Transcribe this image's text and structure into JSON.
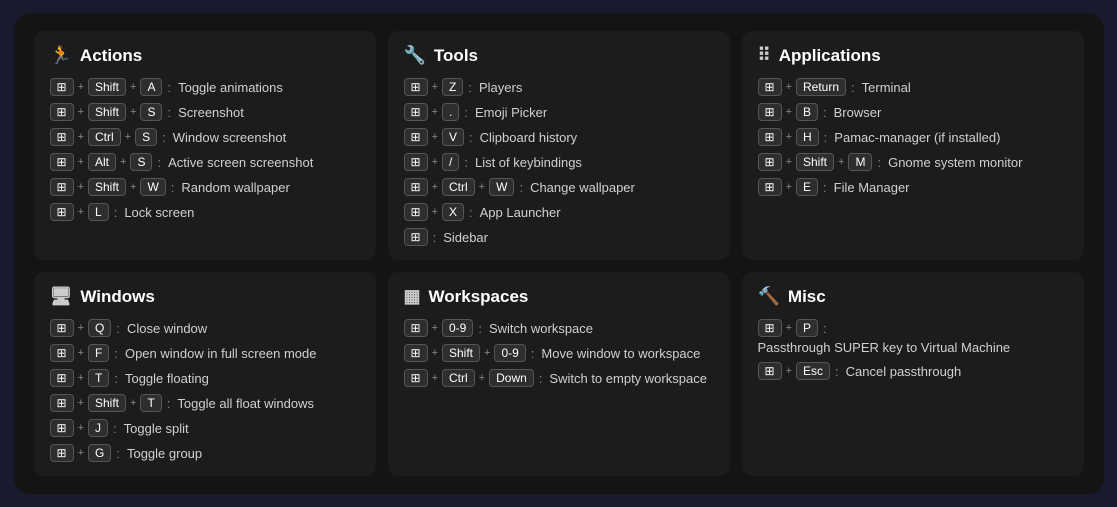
{
  "sections": [
    {
      "id": "actions",
      "icon": "♿",
      "title": "Actions",
      "rows": [
        {
          "keys": [
            [
              "Win"
            ],
            "+",
            [
              "Shift"
            ],
            "+",
            [
              "A"
            ]
          ],
          "label": "Toggle animations"
        },
        {
          "keys": [
            [
              "Win"
            ],
            "+",
            [
              "Shift"
            ],
            "+",
            [
              "S"
            ]
          ],
          "label": "Screenshot"
        },
        {
          "keys": [
            [
              "Win"
            ],
            "+",
            [
              "Ctrl"
            ],
            "+",
            [
              "S"
            ]
          ],
          "label": "Window screenshot"
        },
        {
          "keys": [
            [
              "Win"
            ],
            "+",
            [
              "Alt"
            ],
            "+",
            [
              "S"
            ]
          ],
          "label": "Active screen screenshot"
        },
        {
          "keys": [
            [
              "Win"
            ],
            "+",
            [
              "Shift"
            ],
            "+",
            [
              "W"
            ]
          ],
          "label": "Random wallpaper"
        },
        {
          "keys": [
            [
              "Win"
            ],
            "+",
            [
              "L"
            ]
          ],
          "label": "Lock screen"
        }
      ]
    },
    {
      "id": "tools",
      "icon": "🔧",
      "title": "Tools",
      "rows": [
        {
          "keys": [
            [
              "Win"
            ],
            "+",
            [
              "Z"
            ]
          ],
          "label": "Players"
        },
        {
          "keys": [
            [
              "Win"
            ],
            "+",
            [
              "."
            ]
          ],
          "label": "Emoji Picker"
        },
        {
          "keys": [
            [
              "Win"
            ],
            "+",
            [
              "V"
            ]
          ],
          "label": "Clipboard history"
        },
        {
          "keys": [
            [
              "Win"
            ],
            "+",
            [
              "/"
            ]
          ],
          "label": "List of keybindings"
        },
        {
          "keys": [
            [
              "Win"
            ],
            "+",
            [
              "Ctrl"
            ],
            "+",
            [
              "W"
            ]
          ],
          "label": "Change wallpaper"
        },
        {
          "keys": [
            [
              "Win"
            ],
            "+",
            [
              "X"
            ]
          ],
          "label": "App Launcher"
        },
        {
          "keys": [
            [
              "Win"
            ]
          ],
          "label": "Sidebar"
        }
      ]
    },
    {
      "id": "applications",
      "icon": "⠿",
      "title": "Applications",
      "rows": [
        {
          "keys": [
            [
              "Win"
            ],
            "+",
            [
              "Return"
            ]
          ],
          "label": "Terminal"
        },
        {
          "keys": [
            [
              "Win"
            ],
            "+",
            [
              "B"
            ]
          ],
          "label": "Browser"
        },
        {
          "keys": [
            [
              "Win"
            ],
            "+",
            [
              "H"
            ]
          ],
          "label": "Pamac-manager (if installed)"
        },
        {
          "keys": [
            [
              "Win"
            ],
            "+",
            [
              "Shift"
            ],
            "+",
            [
              "M"
            ]
          ],
          "label": "Gnome system monitor"
        },
        {
          "keys": [
            [
              "Win"
            ],
            "+",
            [
              "E"
            ]
          ],
          "label": "File Manager"
        }
      ]
    },
    {
      "id": "windows",
      "icon": "🖥",
      "title": "Windows",
      "rows": [
        {
          "keys": [
            [
              "Win"
            ],
            "+",
            [
              "Q"
            ]
          ],
          "label": "Close window"
        },
        {
          "keys": [
            [
              "Win"
            ],
            "+",
            [
              "F"
            ]
          ],
          "label": "Open window in full screen mode"
        },
        {
          "keys": [
            [
              "Win"
            ],
            "+",
            [
              "T"
            ]
          ],
          "label": "Toggle floating"
        },
        {
          "keys": [
            [
              "Win"
            ],
            "+",
            [
              "Shift"
            ],
            "+",
            [
              "T"
            ]
          ],
          "label": "Toggle all float windows"
        },
        {
          "keys": [
            [
              "Win"
            ],
            "+",
            [
              "J"
            ]
          ],
          "label": "Toggle split"
        },
        {
          "keys": [
            [
              "Win"
            ],
            "+",
            [
              "G"
            ]
          ],
          "label": "Toggle group"
        }
      ]
    },
    {
      "id": "workspaces",
      "icon": "▦",
      "title": "Workspaces",
      "rows": [
        {
          "keys": [
            [
              "Win"
            ],
            "+",
            [
              "0-9"
            ]
          ],
          "label": "Switch workspace"
        },
        {
          "keys": [
            [
              "Win"
            ],
            "+",
            [
              "Shift"
            ],
            "+",
            [
              "0-9"
            ]
          ],
          "label": "Move window to workspace"
        },
        {
          "keys": [
            [
              "Win"
            ],
            "+",
            [
              "Ctrl"
            ],
            "+",
            [
              "Down"
            ]
          ],
          "label": "Switch to empty workspace"
        }
      ]
    },
    {
      "id": "misc",
      "icon": "🔨",
      "title": "Misc",
      "rows": [
        {
          "keys": [
            [
              "Win"
            ],
            "+",
            [
              "P"
            ]
          ],
          "label": "Passthrough SUPER key to Virtual Machine"
        },
        {
          "keys": [
            [
              "Win"
            ],
            "+",
            [
              "Esc"
            ]
          ],
          "label": "Cancel passthrough"
        }
      ]
    }
  ]
}
